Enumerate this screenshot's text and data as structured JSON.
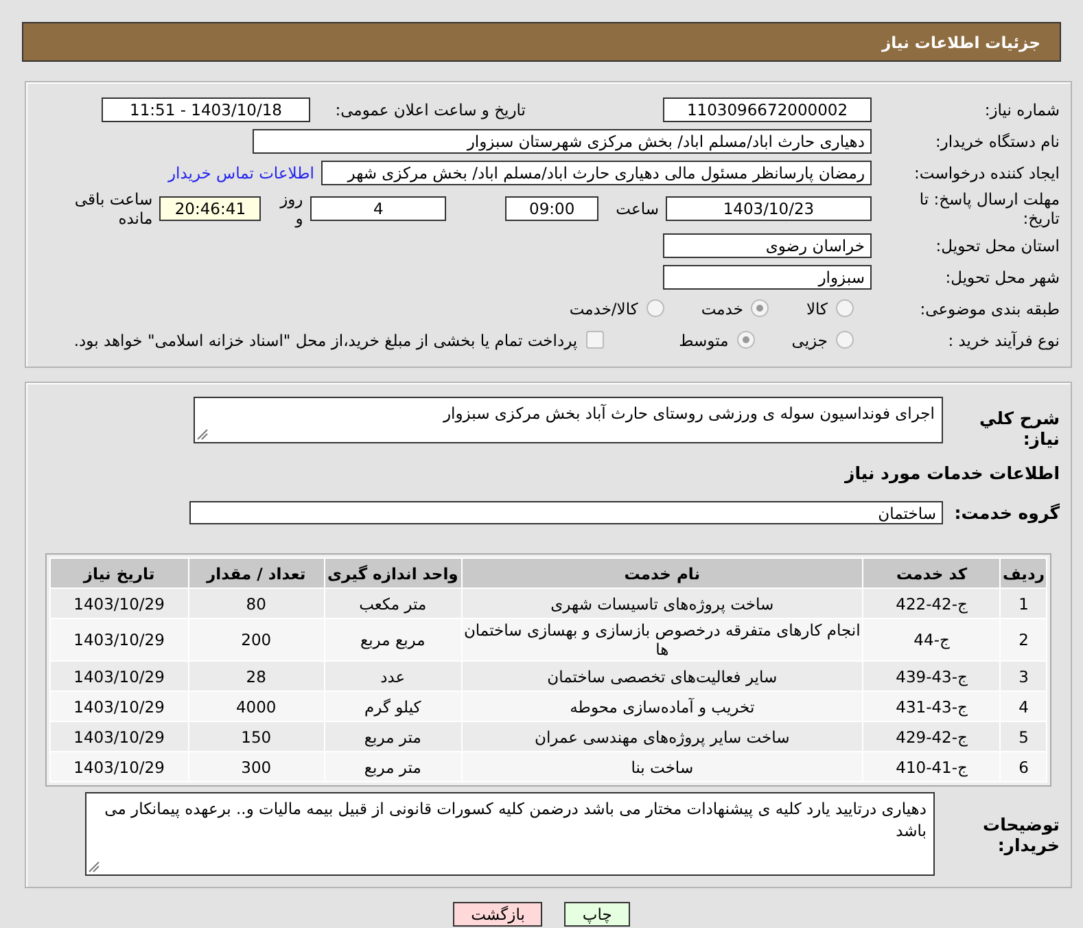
{
  "header": {
    "title": "جزئیات اطلاعات نیاز"
  },
  "details": {
    "need_number": {
      "label": "شماره نیاز:",
      "value": "1103096672000002"
    },
    "announce": {
      "label": "تاریخ و ساعت اعلان عمومی:",
      "value": "1403/10/18 - 11:51"
    },
    "buyer_org": {
      "label": "نام دستگاه خریدار:",
      "value": "دهیاری حارث اباد/مسلم اباد/ بخش مرکزی شهرستان سبزوار"
    },
    "creator": {
      "label": "ایجاد کننده درخواست:",
      "value": "رمضان پارسانظر مسئول مالی دهیاری حارث اباد/مسلم اباد/ بخش مرکزی شهر",
      "link": "اطلاعات تماس خریدار"
    },
    "deadline": {
      "label": "مهلت ارسال پاسخ: تا تاریخ:",
      "date": "1403/10/23",
      "time_label": "ساعت",
      "time": "09:00",
      "days": "4",
      "days_label": "روز و",
      "remaining": "20:46:41",
      "remaining_label": "ساعت باقی مانده"
    },
    "province": {
      "label": "استان محل تحویل:",
      "value": "خراسان رضوی"
    },
    "city": {
      "label": "شهر محل تحویل:",
      "value": "سبزوار"
    },
    "category": {
      "label": "طبقه بندی موضوعی:",
      "options": [
        {
          "label": "کالا",
          "selected": false
        },
        {
          "label": "خدمت",
          "selected": true
        },
        {
          "label": "کالا/خدمت",
          "selected": false
        }
      ]
    },
    "process": {
      "label": "نوع فرآیند خرید :",
      "options": [
        {
          "label": "جزیی",
          "selected": false
        },
        {
          "label": "متوسط",
          "selected": true
        }
      ],
      "payment": {
        "label": "پرداخت تمام یا بخشی از مبلغ خرید،از محل \"اسناد خزانه اسلامی\" خواهد بود.",
        "checked": false
      }
    }
  },
  "description": {
    "label": "شرح کلي نیاز:",
    "value": "اجرای فونداسیون سوله ی ورزشی روستای حارث آباد بخش مرکزی سبزوار"
  },
  "services_heading": "اطلاعات خدمات مورد نیاز",
  "service_group": {
    "label": "گروه خدمت:",
    "value": "ساختمان"
  },
  "table": {
    "columns": [
      "ردیف",
      "کد خدمت",
      "نام خدمت",
      "واحد اندازه گیری",
      "تعداد / مقدار",
      "تاریخ نیاز"
    ],
    "rows": [
      [
        "1",
        "ج-42-422",
        "ساخت پروژه‌های تاسیسات شهری",
        "متر مکعب",
        "80",
        "1403/10/29"
      ],
      [
        "2",
        "ج-44",
        "انجام کارهای متفرقه درخصوص بازسازی و بهسازی ساختمان ها",
        "مربع مربع",
        "200",
        "1403/10/29"
      ],
      [
        "3",
        "ج-43-439",
        "سایر فعالیت‌های تخصصی ساختمان",
        "عدد",
        "28",
        "1403/10/29"
      ],
      [
        "4",
        "ج-43-431",
        "تخریب و آماده‌سازی محوطه",
        "کیلو گرم",
        "4000",
        "1403/10/29"
      ],
      [
        "5",
        "ج-42-429",
        "ساخت سایر پروژه‌های مهندسی عمران",
        "متر مربع",
        "150",
        "1403/10/29"
      ],
      [
        "6",
        "ج-41-410",
        "ساخت بنا",
        "متر مربع",
        "300",
        "1403/10/29"
      ]
    ]
  },
  "buyer_notes": {
    "label": "توضیحات خریدار:",
    "value": "دهیاری درتایید یارد کلیه ی پیشنهادات مختار می باشد درضمن کلیه کسورات قانونی از قبیل بیمه مالیات و.. برعهده پیمانکار می باشد"
  },
  "buttons": [
    {
      "label": "چاپ",
      "kind": "print"
    },
    {
      "label": "بازگشت",
      "kind": "back"
    }
  ]
}
